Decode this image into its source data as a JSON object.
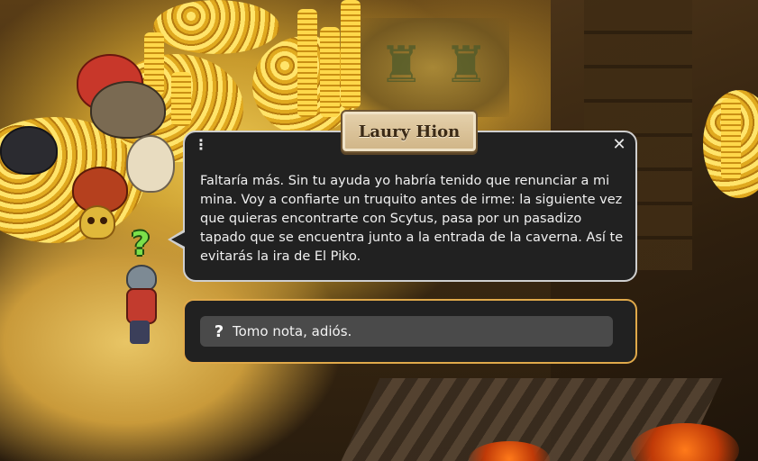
{
  "npc": {
    "name": "Laury Hion"
  },
  "dialog": {
    "text": "Faltaría más. Sin tu ayuda yo habría tenido que renunciar a mi mina. Voy a confiarte un truquito antes de irme: la siguiente vez que quieras encontrarte con Scytus, pasa por un pasadizo tapado que se encuentra junto a la entrada de la caverna. Así te evitarás la ira de El Piko.",
    "menu_icon": "⋮",
    "close_icon": "✕"
  },
  "replies": [
    {
      "icon": "?",
      "label": "Tomo nota, adiós."
    }
  ],
  "scene": {
    "quest_marker": "?"
  },
  "colors": {
    "dialog_bg": "#212121",
    "dialog_border": "#cfcfcf",
    "reply_border": "#e0a94a",
    "reply_option_bg": "#4a4a4a",
    "quest_marker": "#7be04a",
    "name_plate": "#e6d2ad"
  }
}
